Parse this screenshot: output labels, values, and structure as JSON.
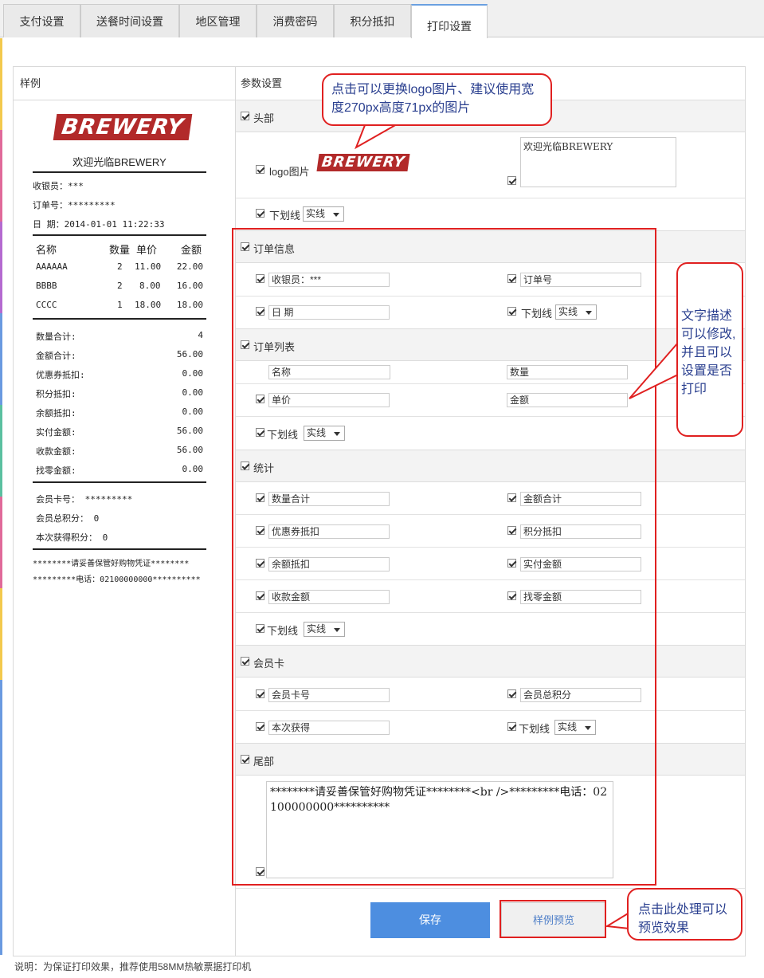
{
  "tabs": [
    {
      "label": "支付设置"
    },
    {
      "label": "送餐时间设置"
    },
    {
      "label": "地区管理"
    },
    {
      "label": "消费密码"
    },
    {
      "label": "积分抵扣"
    },
    {
      "label": "打印设置"
    }
  ],
  "left_header": "样例",
  "right_header": "参数设置",
  "logo_text": "BREWERY",
  "receipt": {
    "welcome": "欢迎光临BREWERY",
    "cashier": "收银员：***",
    "order_no": "订单号：*********",
    "date": "日 期：2014-01-01 11:22:33",
    "col_name": "名称",
    "col_qty": "数量",
    "col_price": "单价",
    "col_amount": "金额",
    "items": [
      {
        "name": "AAAAAA",
        "qty": "2",
        "price": "11.00",
        "amount": "22.00"
      },
      {
        "name": "BBBB",
        "qty": "2",
        "price": "8.00",
        "amount": "16.00"
      },
      {
        "name": "CCCC",
        "qty": "1",
        "price": "18.00",
        "amount": "18.00"
      }
    ],
    "stats": [
      {
        "label": "数量合计:",
        "value": "4"
      },
      {
        "label": "金额合计:",
        "value": "56.00"
      },
      {
        "label": "优惠券抵扣:",
        "value": "0.00"
      },
      {
        "label": "积分抵扣:",
        "value": "0.00"
      },
      {
        "label": "余额抵扣:",
        "value": "0.00"
      },
      {
        "label": "实付金额:",
        "value": "56.00"
      },
      {
        "label": "收款金额:",
        "value": "56.00"
      },
      {
        "label": "找零金额:",
        "value": "0.00"
      }
    ],
    "card_no": "会员卡号：  *********",
    "total_points": "会员总积分：  0",
    "earned_points": "本次获得积分：  0",
    "footer1": "********请妥善保管好购物凭证********",
    "footer2": "*********电话：02100000000**********"
  },
  "settings": {
    "header_section": "头部",
    "logo_label": "logo图片",
    "welcome_value": "欢迎光临BREWERY",
    "underline_label": "下划线",
    "underline_value": "实线",
    "order_section": "订单信息",
    "cashier_value": "收银员：***",
    "order_no_value": "订单号",
    "date_value": "日  期",
    "list_section": "订单列表",
    "name_value": "名称",
    "qty_value": "数量",
    "price_value": "单价",
    "amount_value": "金额",
    "stats_section": "统计",
    "qty_total": "数量合计",
    "amount_total": "金额合计",
    "coupon": "优惠券抵扣",
    "points_deduct": "积分抵扣",
    "balance": "余额抵扣",
    "paid": "实付金额",
    "received": "收款金额",
    "change": "找零金额",
    "member_section": "会员卡",
    "card_no": "会员卡号",
    "total_points": "会员总积分",
    "earned_points": "本次获得",
    "footer_section": "尾部",
    "footer_value": "********请妥善保管好购物凭证********<br />*********电话：02100000000**********"
  },
  "buttons": {
    "save": "保存",
    "preview": "样例预览"
  },
  "callouts": {
    "logo": "点击可以更换logo图片、建议使用宽度270px高度71px的图片",
    "text": "文字描述可以修改,并且可以设置是否打印",
    "preview": "点击此处理可以预览效果"
  },
  "note": "说明：为保证打印效果，推荐使用58MM热敏票据打印机",
  "colors": {
    "accent": "#4d8ee0",
    "callout_border": "#e02020",
    "logo_bg": "#b22a2a"
  }
}
